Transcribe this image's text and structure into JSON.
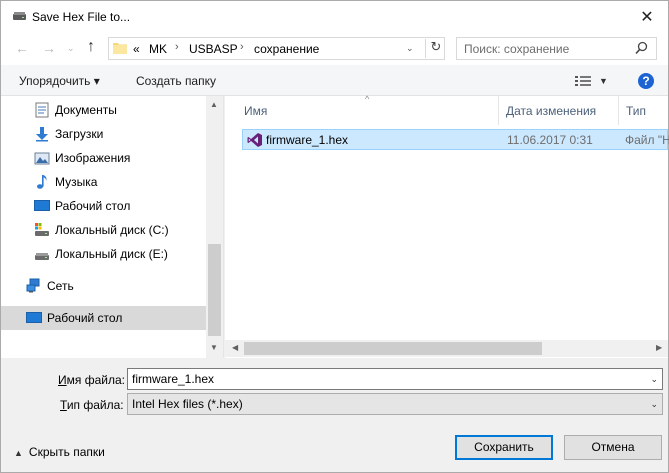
{
  "window": {
    "title": "Save Hex File to...",
    "close_glyph": "✕"
  },
  "nav": {
    "back_glyph": "←",
    "forward_glyph": "→",
    "recent_glyph": "⌄",
    "up_glyph": "↑",
    "breadcrumb_overflow": "«",
    "breadcrumbs": [
      "MK",
      "USBASP",
      "сохранение"
    ],
    "refresh_glyph": "↻",
    "search_placeholder": "Поиск: сохранение"
  },
  "toolbar": {
    "organize_label": "Упорядочить ▾",
    "new_folder_label": "Создать папку",
    "help_glyph": "?"
  },
  "sidebar": {
    "items": [
      {
        "label": "Документы",
        "icon": "documents-icon"
      },
      {
        "label": "Загрузки",
        "icon": "downloads-icon"
      },
      {
        "label": "Изображения",
        "icon": "pictures-icon"
      },
      {
        "label": "Музыка",
        "icon": "music-icon"
      },
      {
        "label": "Рабочий стол",
        "icon": "desktop-icon"
      },
      {
        "label": "Локальный диск (C:)",
        "icon": "drive-c-icon"
      },
      {
        "label": "Локальный диск (E:)",
        "icon": "drive-e-icon"
      },
      {
        "label": "Сеть",
        "icon": "network-icon"
      },
      {
        "label": "Рабочий стол",
        "icon": "desktop-icon",
        "selected": true
      }
    ]
  },
  "filelist": {
    "columns": {
      "name": "Имя",
      "date": "Дата изменения",
      "type": "Тип"
    },
    "files": [
      {
        "name": "firmware_1.hex",
        "date": "11.06.2017 0:31",
        "type": "Файл \"HEX\"",
        "icon": "visual-studio-icon"
      }
    ]
  },
  "form": {
    "filename_label_u": "И",
    "filename_label_rest": "мя файла:",
    "filename_value": "firmware_1.hex",
    "filetype_label_u": "Т",
    "filetype_label_rest": "ип файла:",
    "filetype_value": "Intel Hex files (*.hex)",
    "hide_folders_label": "Скрыть папки",
    "save_label": "Сохранить",
    "cancel_label": "Отмена"
  },
  "colors": {
    "selection": "#cce8ff",
    "accent": "#0078d7",
    "help": "#1c63d4"
  }
}
